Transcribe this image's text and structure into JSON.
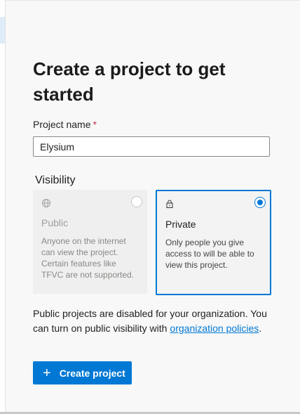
{
  "page": {
    "title": "Create a project to get started"
  },
  "project_name": {
    "label": "Project name",
    "required_marker": "*",
    "value": "Elysium"
  },
  "visibility": {
    "label": "Visibility",
    "options": [
      {
        "title": "Public",
        "description": "Anyone on the internet can view the project. Certain features like TFVC are not supported.",
        "icon": "globe-icon",
        "selected": false,
        "disabled": true
      },
      {
        "title": "Private",
        "description": "Only people you give access to will be able to view this project.",
        "icon": "lock-icon",
        "selected": true,
        "disabled": false
      }
    ]
  },
  "notice": {
    "text": "Public projects are disabled for your organization. You can turn on public visibility with",
    "link_text": "organization policies",
    "suffix": "."
  },
  "create_button": {
    "icon": "plus-icon",
    "label": "Create project"
  },
  "colors": {
    "accent": "#0078d4",
    "required": "#c4314b",
    "panel_background": "#f8f8f8"
  }
}
